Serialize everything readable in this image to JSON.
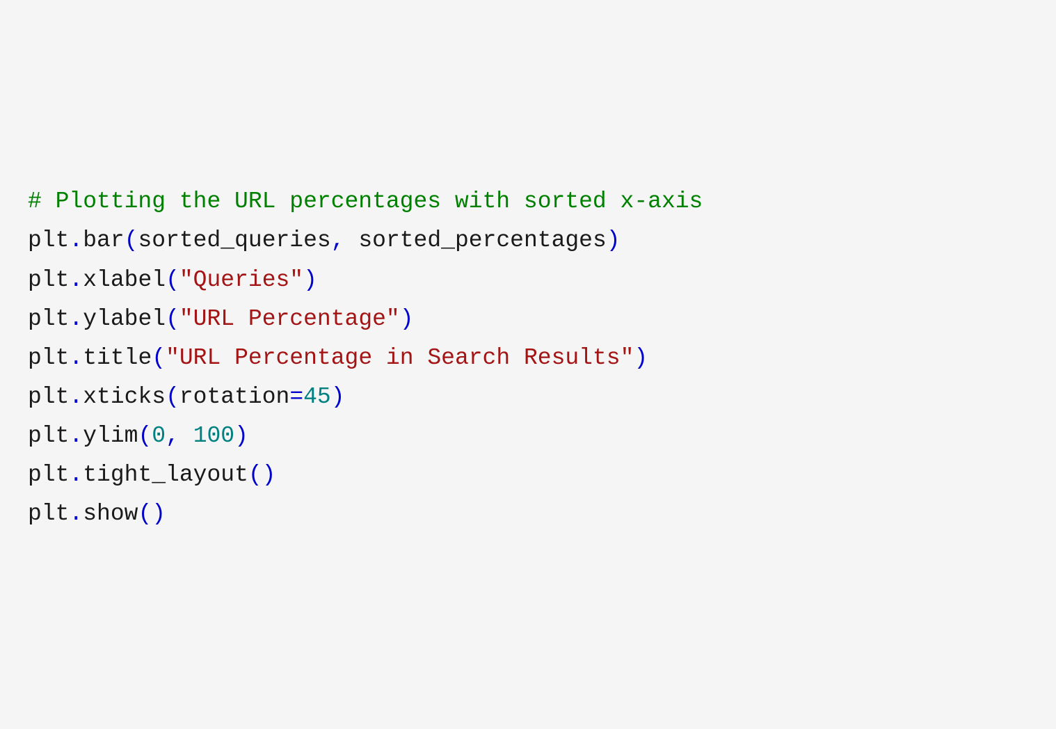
{
  "code": {
    "lines": [
      {
        "tokens": [
          {
            "type": "comment",
            "text": "# Plotting the URL percentages with sorted x-axis"
          }
        ]
      },
      {
        "tokens": [
          {
            "type": "identifier",
            "text": "plt"
          },
          {
            "type": "punct",
            "text": "."
          },
          {
            "type": "identifier",
            "text": "bar"
          },
          {
            "type": "punct",
            "text": "("
          },
          {
            "type": "identifier",
            "text": "sorted_queries"
          },
          {
            "type": "punct",
            "text": ","
          },
          {
            "type": "identifier",
            "text": " sorted_percentages"
          },
          {
            "type": "punct",
            "text": ")"
          }
        ]
      },
      {
        "tokens": [
          {
            "type": "identifier",
            "text": "plt"
          },
          {
            "type": "punct",
            "text": "."
          },
          {
            "type": "identifier",
            "text": "xlabel"
          },
          {
            "type": "punct",
            "text": "("
          },
          {
            "type": "string",
            "text": "\"Queries\""
          },
          {
            "type": "punct",
            "text": ")"
          }
        ]
      },
      {
        "tokens": [
          {
            "type": "identifier",
            "text": "plt"
          },
          {
            "type": "punct",
            "text": "."
          },
          {
            "type": "identifier",
            "text": "ylabel"
          },
          {
            "type": "punct",
            "text": "("
          },
          {
            "type": "string",
            "text": "\"URL Percentage\""
          },
          {
            "type": "punct",
            "text": ")"
          }
        ]
      },
      {
        "tokens": [
          {
            "type": "identifier",
            "text": "plt"
          },
          {
            "type": "punct",
            "text": "."
          },
          {
            "type": "identifier",
            "text": "title"
          },
          {
            "type": "punct",
            "text": "("
          },
          {
            "type": "string",
            "text": "\"URL Percentage in Search Results\""
          },
          {
            "type": "punct",
            "text": ")"
          }
        ]
      },
      {
        "tokens": [
          {
            "type": "identifier",
            "text": "plt"
          },
          {
            "type": "punct",
            "text": "."
          },
          {
            "type": "identifier",
            "text": "xticks"
          },
          {
            "type": "punct",
            "text": "("
          },
          {
            "type": "identifier",
            "text": "rotation"
          },
          {
            "type": "punct",
            "text": "="
          },
          {
            "type": "number",
            "text": "45"
          },
          {
            "type": "punct",
            "text": ")"
          }
        ]
      },
      {
        "tokens": [
          {
            "type": "identifier",
            "text": "plt"
          },
          {
            "type": "punct",
            "text": "."
          },
          {
            "type": "identifier",
            "text": "ylim"
          },
          {
            "type": "punct",
            "text": "("
          },
          {
            "type": "number",
            "text": "0"
          },
          {
            "type": "punct",
            "text": ","
          },
          {
            "type": "identifier",
            "text": " "
          },
          {
            "type": "number",
            "text": "100"
          },
          {
            "type": "punct",
            "text": ")"
          }
        ]
      },
      {
        "tokens": [
          {
            "type": "identifier",
            "text": "plt"
          },
          {
            "type": "punct",
            "text": "."
          },
          {
            "type": "identifier",
            "text": "tight_layout"
          },
          {
            "type": "punct",
            "text": "()"
          }
        ]
      },
      {
        "tokens": [
          {
            "type": "identifier",
            "text": "plt"
          },
          {
            "type": "punct",
            "text": "."
          },
          {
            "type": "identifier",
            "text": "show"
          },
          {
            "type": "punct",
            "text": "()"
          }
        ]
      }
    ]
  }
}
